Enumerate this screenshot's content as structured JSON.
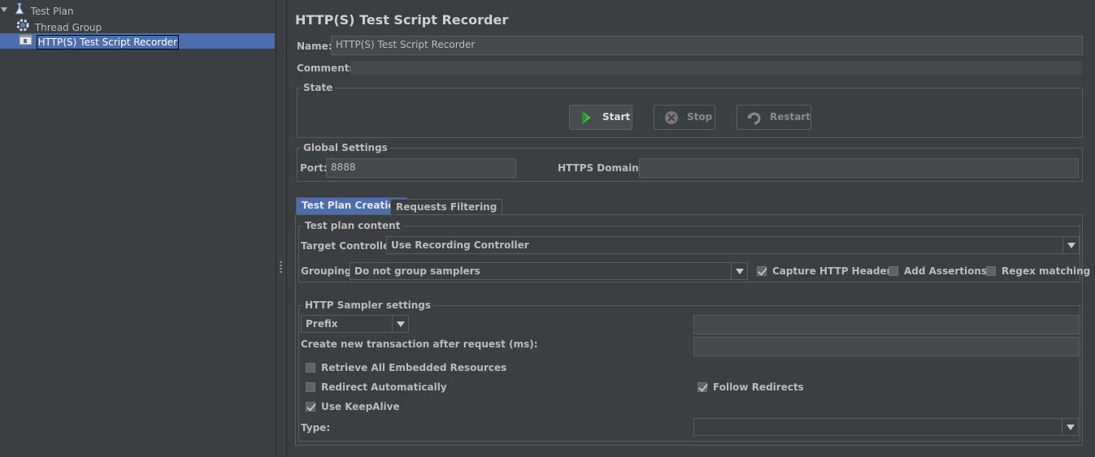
{
  "tree": {
    "items": [
      {
        "label": "Test Plan",
        "icon": "test-plan-icon"
      },
      {
        "label": "Thread Group",
        "icon": "gear-icon"
      },
      {
        "label": "HTTP(S) Test Script Recorder",
        "icon": "recorder-icon"
      }
    ]
  },
  "panel": {
    "title": "HTTP(S) Test Script Recorder",
    "name_label": "Name:",
    "name_value": "HTTP(S) Test Script Recorder",
    "comments_label": "Comments:"
  },
  "state": {
    "title": "State",
    "start_label": "Start",
    "stop_label": "Stop",
    "restart_label": "Restart"
  },
  "global": {
    "title": "Global Settings",
    "port_label": "Port:",
    "port_value": "8888",
    "https_label": "HTTPS Domains:",
    "https_value": ""
  },
  "tabs": [
    {
      "label": "Test Plan Creation",
      "active": true
    },
    {
      "label": "Requests Filtering",
      "active": false
    }
  ],
  "content": {
    "title": "Test plan content",
    "target_label": "Target Controller:",
    "target_value": "Use Recording Controller",
    "grouping_label": "Grouping:",
    "grouping_value": "Do not group samplers",
    "capture_headers": {
      "label": "Capture HTTP Headers",
      "checked": true
    },
    "add_assertions": {
      "label": "Add Assertions",
      "checked": false
    },
    "regex_matching": {
      "label": "Regex matching",
      "checked": false
    }
  },
  "sampler": {
    "title": "HTTP Sampler settings",
    "prefix_value": "Prefix",
    "prefix_text": "",
    "transaction_label": "Create new transaction after request (ms):",
    "transaction_value": "",
    "retrieve_embedded": {
      "label": "Retrieve All Embedded Resources",
      "checked": false
    },
    "redirect_auto": {
      "label": "Redirect Automatically",
      "checked": false
    },
    "follow_redirects": {
      "label": "Follow Redirects",
      "checked": true
    },
    "keepalive": {
      "label": "Use KeepAlive",
      "checked": true
    },
    "type_label": "Type:",
    "type_value": ""
  },
  "colors": {
    "background": "#3c3f41",
    "selection": "#4b6eaf",
    "start_icon": "#3dbb3d"
  }
}
